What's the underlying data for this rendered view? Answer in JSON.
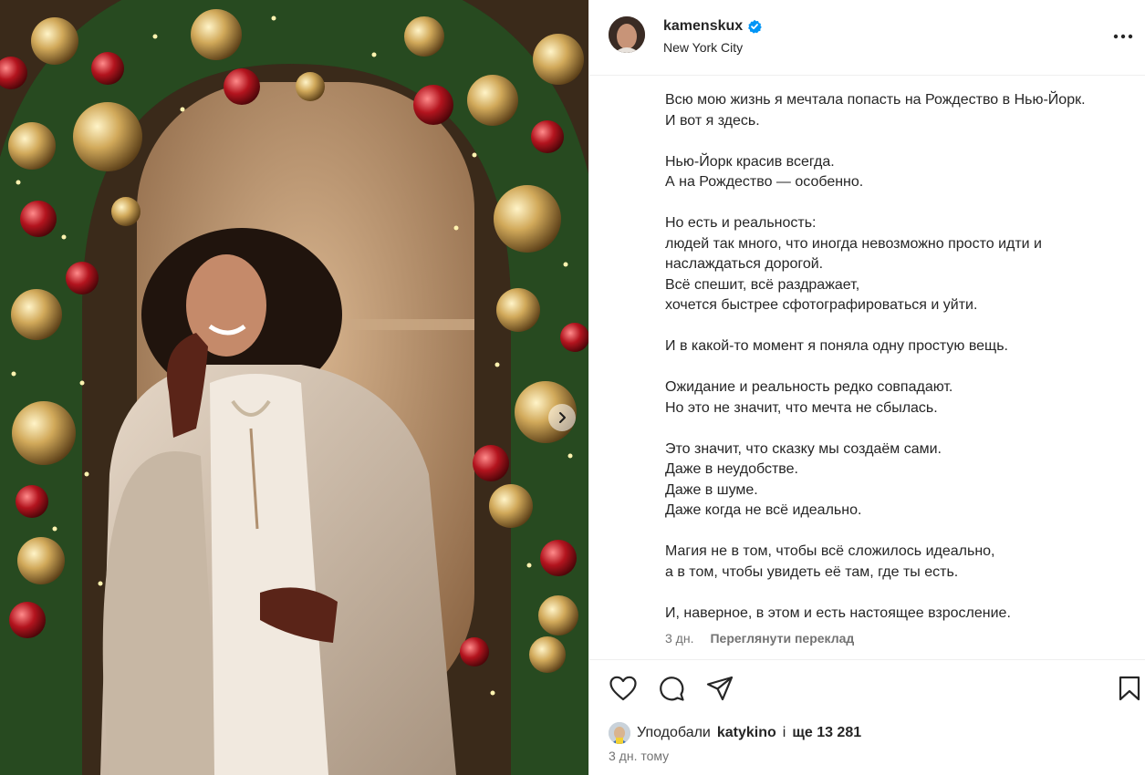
{
  "post": {
    "username": "kamenskux",
    "verified": true,
    "location": "New York City",
    "caption_lines": [
      "Всю мою жизнь я мечтала попасть на Рождество в Нью-Йорк.",
      "И вот я здесь.",
      "",
      "Нью-Йорк красив всегда.",
      "А на Рождество — особенно.",
      "",
      "Но есть и реальность:",
      "людей так много, что иногда невозможно просто идти и",
      "наслаждаться дорогой.",
      "Всё спешит, всё раздражает,",
      "хочется быстрее сфотографироваться и уйти.",
      "",
      "И в какой-то момент я поняла одну простую вещь.",
      "",
      "Ожидание и реальность редко совпадают.",
      "Но это не значит, что мечта не сбылась.",
      "",
      "Это значит, что сказку мы создаём сами.",
      "Даже в неудобстве.",
      "Даже в шуме.",
      "Даже когда не всё идеально.",
      "",
      "Магия не в том, чтобы всё сложилось идеально,",
      "а в том, чтобы увидеть её там, где ты есть.",
      "",
      "И, наверное, в этом и есть настоящее взросление."
    ],
    "caption_time": "3 дн.",
    "translate_label": "Переглянути переклад",
    "likes_prefix": "Уподобали",
    "likes_user": "katykino",
    "likes_and": "і",
    "likes_count": "ще 13 281",
    "posted_ago": "3 дн. тому"
  },
  "icons": {
    "verified": "verified-badge-icon",
    "more": "more-options-icon",
    "like": "heart-icon",
    "comment": "comment-icon",
    "share": "share-icon",
    "save": "bookmark-icon",
    "next": "chevron-right-icon"
  },
  "colors": {
    "verified": "#0095f6",
    "text": "#262626",
    "secondary": "#737373",
    "divider": "#efefef"
  }
}
